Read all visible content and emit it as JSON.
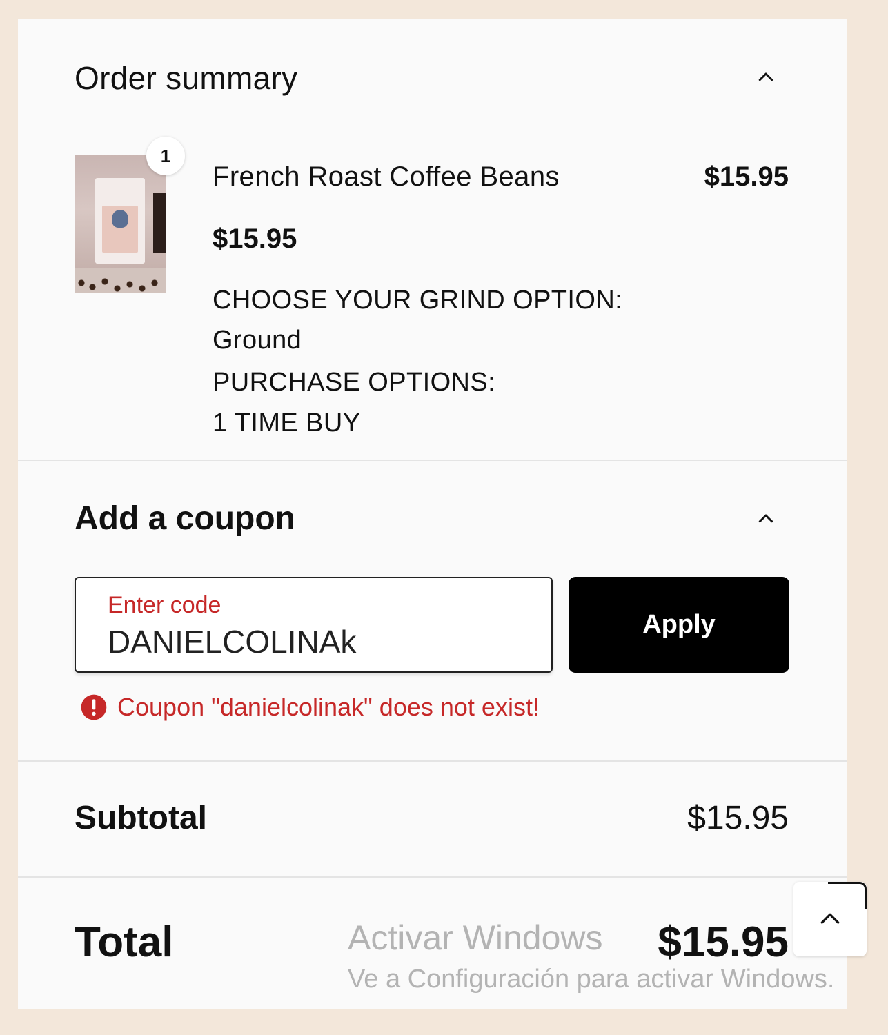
{
  "order_summary": {
    "title": "Order summary",
    "item": {
      "quantity": "1",
      "name": "French Roast Coffee Beans",
      "line_price": "$15.95",
      "unit_price": "$15.95",
      "options": [
        "CHOOSE YOUR GRIND OPTION:",
        "Ground",
        "PURCHASE OPTIONS:",
        "1 TIME BUY"
      ]
    }
  },
  "coupon": {
    "title": "Add a coupon",
    "field_label": "Enter code",
    "field_value": "DANIELCOLINAk",
    "apply_label": "Apply",
    "error": "Coupon \"danielcolinak\" does not exist!"
  },
  "totals": {
    "subtotal_label": "Subtotal",
    "subtotal_value": "$15.95",
    "total_label": "Total",
    "total_value": "$15.95"
  },
  "watermark": {
    "title": "Activar Windows",
    "subtitle": "Ve a Configuración para activar Windows."
  },
  "colors": {
    "page_bg": "#f3e7da",
    "panel_bg": "#fafafa",
    "error": "#c62828",
    "button": "#000000"
  },
  "icons": [
    "chevron-up-icon",
    "error-icon",
    "scroll-top-chevron-icon"
  ]
}
